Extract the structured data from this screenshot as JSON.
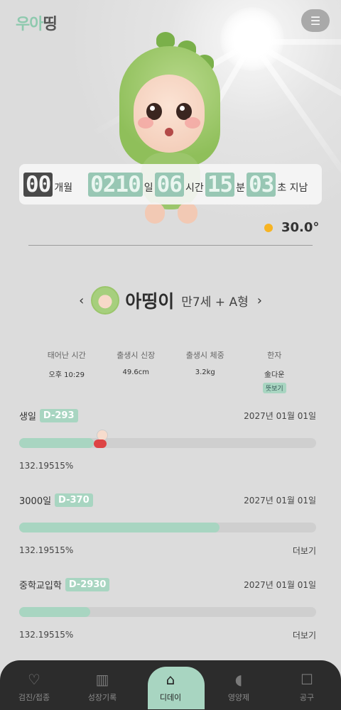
{
  "app": {
    "logo_part1": "우아",
    "logo_part2": "띵",
    "menu_icon": "hamburger-icon"
  },
  "timer": [
    {
      "digits": "00",
      "unit": "개월",
      "style": "dark"
    },
    {
      "digits": "0210",
      "unit": "일",
      "style": "green"
    },
    {
      "digits": "06",
      "unit": "시간",
      "style": "green"
    },
    {
      "digits": "15",
      "unit": "분",
      "style": "green"
    },
    {
      "digits": "03",
      "unit": "초 지남",
      "style": "green"
    }
  ],
  "weather": {
    "icon": "sun-icon",
    "temperature": "30.0°"
  },
  "profile": {
    "prev_icon": "chevron-left-icon",
    "next_icon": "chevron-right-icon",
    "name": "아띵이",
    "detail": "만7세 + A형"
  },
  "info": {
    "birth_time": {
      "label": "태어난 시간",
      "value": "오후 10:29"
    },
    "birth_height": {
      "label": "출생시 신장",
      "value": "49.6cm"
    },
    "birth_weight": {
      "label": "출생시 체중",
      "value": "3.2kg"
    },
    "hanja": {
      "label": "한자",
      "value": "金다운",
      "tag": "뜻보기"
    }
  },
  "ddays": [
    {
      "name": "생일",
      "badge": "D-293",
      "date": "2027년 01월 01일",
      "progress": 0.25,
      "percent_text": "132.19515%",
      "more": ""
    },
    {
      "name": "3000일",
      "badge": "D-370",
      "date": "2027년 01월 01일",
      "progress": 0.675,
      "percent_text": "132.19515%",
      "more": "더보기"
    },
    {
      "name": "중학교입학",
      "badge": "D-2930",
      "date": "2027년 01월 01일",
      "progress": 0.24,
      "percent_text": "132.19515%",
      "more": "더보기"
    }
  ],
  "nav": [
    {
      "label": "검진/접종",
      "icon": "heartbeat-icon",
      "glyph": "♡",
      "active": false
    },
    {
      "label": "성장기록",
      "icon": "bar-chart-icon",
      "glyph": "▥",
      "active": false
    },
    {
      "label": "디데이",
      "icon": "home-face-icon",
      "glyph": "⌂",
      "active": true
    },
    {
      "label": "영양제",
      "icon": "pill-icon",
      "glyph": "◖",
      "active": false
    },
    {
      "label": "공구",
      "icon": "shopping-bag-icon",
      "glyph": "☐",
      "active": false
    }
  ],
  "colors": {
    "accent": "#a8d5c1",
    "dark": "#2c2c2c",
    "sun": "#f7b423"
  }
}
